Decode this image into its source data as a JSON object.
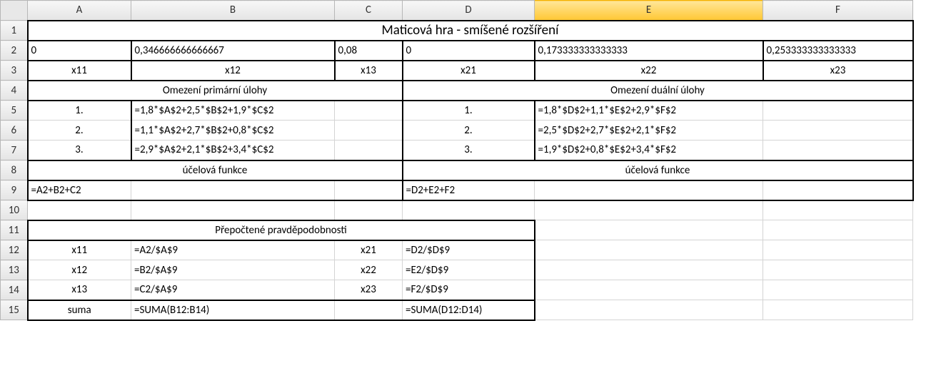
{
  "columns": [
    "A",
    "B",
    "C",
    "D",
    "E",
    "F"
  ],
  "rows": [
    "1",
    "2",
    "3",
    "4",
    "5",
    "6",
    "7",
    "8",
    "9",
    "10",
    "11",
    "12",
    "13",
    "14",
    "15"
  ],
  "selectedColumn": "E",
  "cells": {
    "r1": {
      "title": "Maticová hra - smíšené rozšíření"
    },
    "r2": {
      "A": "0",
      "B": "0,346666666666667",
      "C": "0,08",
      "D": "0",
      "E": "0,173333333333333",
      "F": "0,253333333333333"
    },
    "r3": {
      "A": "x11",
      "B": "x12",
      "C": "x13",
      "D": "x21",
      "E": "x22",
      "F": "x23"
    },
    "r4": {
      "primLabel": "Omezení primární úlohy",
      "dualLabel": "Omezení duální úlohy"
    },
    "r5": {
      "A": "1.",
      "B": "=1,8*$A$2+2,5*$B$2+1,9*$C$2",
      "D": "1.",
      "E": "=1,8*$D$2+1,1*$E$2+2,9*$F$2"
    },
    "r6": {
      "A": "2.",
      "B": "=1,1*$A$2+2,7*$B$2+0,8*$C$2",
      "D": "2.",
      "E": "=2,5*$D$2+2,7*$E$2+2,1*$F$2"
    },
    "r7": {
      "A": "3.",
      "B": "=2,9*$A$2+2,1*$B$2+3,4*$C$2",
      "D": "3.",
      "E": "=1,9*$D$2+0,8*$E$2+3,4*$F$2"
    },
    "r8": {
      "primFn": "účelová funkce",
      "dualFn": "účelová funkce"
    },
    "r9": {
      "A": "=A2+B2+C2",
      "D": "=D2+E2+F2"
    },
    "r11": {
      "title": "Přepočtené pravděpodobnosti"
    },
    "r12": {
      "A": "x11",
      "B": "=A2/$A$9",
      "C": "x21",
      "D": "=D2/$D$9"
    },
    "r13": {
      "A": "x12",
      "B": "=B2/$A$9",
      "C": "x22",
      "D": "=E2/$D$9"
    },
    "r14": {
      "A": "x13",
      "B": "=C2/$A$9",
      "C": "x23",
      "D": "=F2/$D$9"
    },
    "r15": {
      "A": "suma",
      "B": "=SUMA(B12:B14)",
      "D": "=SUMA(D12:D14)"
    }
  }
}
